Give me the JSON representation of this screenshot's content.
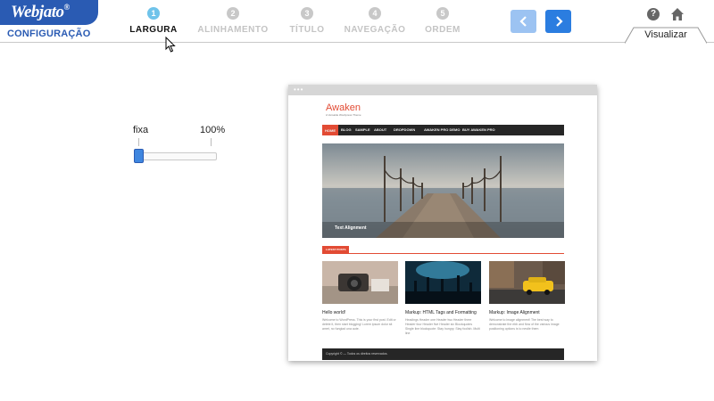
{
  "header": {
    "logo_text": "Webjato",
    "logo_reg": "®",
    "config_label": "CONFIGURAÇÃO",
    "steps": [
      {
        "number": "1",
        "label": "LARGURA",
        "active": true
      },
      {
        "number": "2",
        "label": "ALINHAMENTO",
        "active": false
      },
      {
        "number": "3",
        "label": "TÍTULO",
        "active": false
      },
      {
        "number": "4",
        "label": "NAVEGAÇÃO",
        "active": false
      },
      {
        "number": "5",
        "label": "ORDEM",
        "active": false
      }
    ],
    "prev_icon": "chevron-left-icon",
    "next_icon": "chevron-right-icon",
    "help_text": "?",
    "help_icon": "help-icon",
    "home_icon": "home-icon",
    "visualizar_label": "Visualizar"
  },
  "width_slider": {
    "min_label": "fixa",
    "max_label": "100%",
    "value_fraction": 0.0
  },
  "preview": {
    "site_title": "Awaken",
    "site_tagline": "A Versatile Wordpress Theme",
    "nav_items": [
      "HOME",
      "BLOG",
      "SAMPLE",
      "ABOUT",
      "DROPDOWN",
      "AWAKEN PRO DEMO",
      "BUY AWAKEN PRO"
    ],
    "hero_caption": "Text Alignment",
    "latest_posts_label": "LATEST POSTS",
    "posts": [
      {
        "title": "Hello world!",
        "excerpt": "Welcome to WordPress. This is your first post. Edit or delete it, then start blogging! Lorem ipsum dolor sit amet, no fungiad una aute."
      },
      {
        "title": "Markup: HTML Tags and Formatting",
        "excerpt": "Headings Header one Header two Header three Header four Header five Header six Blockquotes Single line blockquote: Stay hungry. Stay foolish. Multi line"
      },
      {
        "title": "Markup: Image Alignment",
        "excerpt": "Welcome to image alignment! The best way to demonstrate the ebb and flow of the various image positioning options is to nestle them"
      }
    ],
    "footer_text": "Copyright © — Todos os direitos reservados."
  },
  "colors": {
    "brand_blue": "#2a5bb3",
    "active_step": "#6fc3ea",
    "nav_button": "#2b7de0",
    "site_accent": "#e24b34"
  }
}
